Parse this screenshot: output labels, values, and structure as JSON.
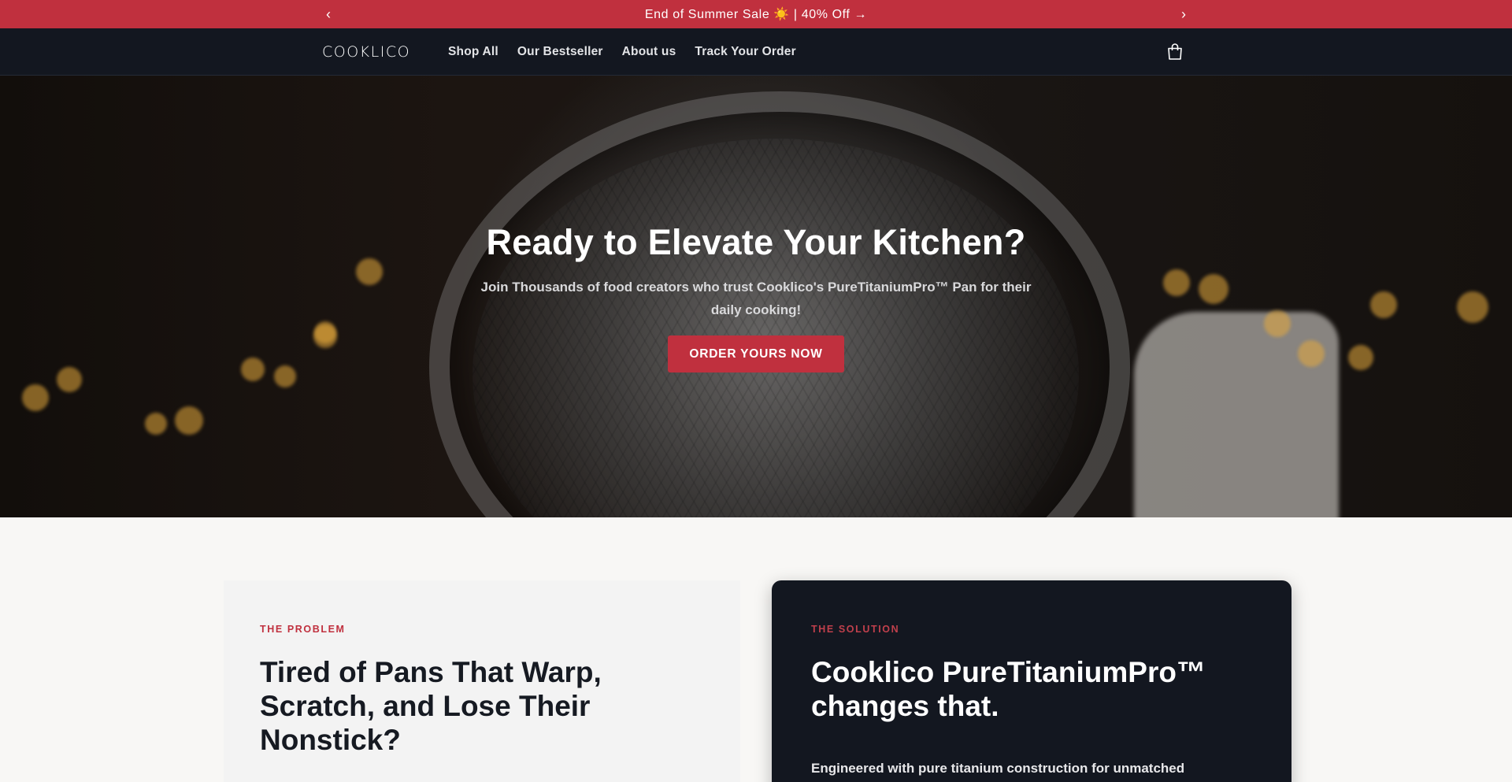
{
  "announcement": {
    "prev_arrow": "‹",
    "next_arrow": "›",
    "message": "End of Summer Sale ☀️ | 40% Off →"
  },
  "header": {
    "logo": "COOKLICO",
    "nav": [
      "Shop All",
      "Our Bestseller",
      "About us",
      "Track Your Order"
    ],
    "cart_icon": "shopping-bag-icon"
  },
  "hero": {
    "title": "Ready to Elevate Your Kitchen?",
    "subtitle": "Join Thousands of food creators who trust Cooklico's PureTitaniumPro™ Pan for their daily cooking!",
    "cta": "ORDER YOURS NOW"
  },
  "problem": {
    "eyebrow": "THE PROBLEM",
    "title": "Tired of Pans That Warp, Scratch, and Lose Their Nonstick?"
  },
  "solution": {
    "eyebrow": "THE SOLUTION",
    "title": "Cooklico PureTitaniumPro™ changes that.",
    "body": "Engineered with pure titanium construction for unmatched"
  },
  "colors": {
    "accent": "#c0303e",
    "header_bg": "#131720",
    "page_bg": "#f8f7f5"
  }
}
